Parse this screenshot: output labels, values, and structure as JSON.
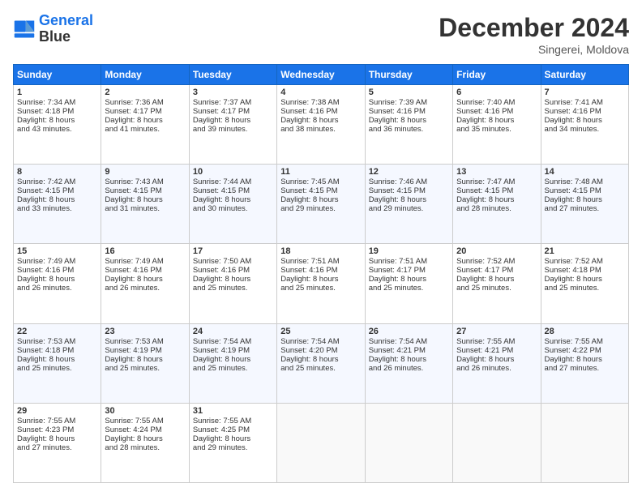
{
  "header": {
    "logo_line1": "General",
    "logo_line2": "Blue",
    "month_title": "December 2024",
    "location": "Singerei, Moldova"
  },
  "weekdays": [
    "Sunday",
    "Monday",
    "Tuesday",
    "Wednesday",
    "Thursday",
    "Friday",
    "Saturday"
  ],
  "weeks": [
    [
      {
        "day": "1",
        "lines": [
          "Sunrise: 7:34 AM",
          "Sunset: 4:18 PM",
          "Daylight: 8 hours",
          "and 43 minutes."
        ]
      },
      {
        "day": "2",
        "lines": [
          "Sunrise: 7:36 AM",
          "Sunset: 4:17 PM",
          "Daylight: 8 hours",
          "and 41 minutes."
        ]
      },
      {
        "day": "3",
        "lines": [
          "Sunrise: 7:37 AM",
          "Sunset: 4:17 PM",
          "Daylight: 8 hours",
          "and 39 minutes."
        ]
      },
      {
        "day": "4",
        "lines": [
          "Sunrise: 7:38 AM",
          "Sunset: 4:16 PM",
          "Daylight: 8 hours",
          "and 38 minutes."
        ]
      },
      {
        "day": "5",
        "lines": [
          "Sunrise: 7:39 AM",
          "Sunset: 4:16 PM",
          "Daylight: 8 hours",
          "and 36 minutes."
        ]
      },
      {
        "day": "6",
        "lines": [
          "Sunrise: 7:40 AM",
          "Sunset: 4:16 PM",
          "Daylight: 8 hours",
          "and 35 minutes."
        ]
      },
      {
        "day": "7",
        "lines": [
          "Sunrise: 7:41 AM",
          "Sunset: 4:16 PM",
          "Daylight: 8 hours",
          "and 34 minutes."
        ]
      }
    ],
    [
      {
        "day": "8",
        "lines": [
          "Sunrise: 7:42 AM",
          "Sunset: 4:15 PM",
          "Daylight: 8 hours",
          "and 33 minutes."
        ]
      },
      {
        "day": "9",
        "lines": [
          "Sunrise: 7:43 AM",
          "Sunset: 4:15 PM",
          "Daylight: 8 hours",
          "and 31 minutes."
        ]
      },
      {
        "day": "10",
        "lines": [
          "Sunrise: 7:44 AM",
          "Sunset: 4:15 PM",
          "Daylight: 8 hours",
          "and 30 minutes."
        ]
      },
      {
        "day": "11",
        "lines": [
          "Sunrise: 7:45 AM",
          "Sunset: 4:15 PM",
          "Daylight: 8 hours",
          "and 29 minutes."
        ]
      },
      {
        "day": "12",
        "lines": [
          "Sunrise: 7:46 AM",
          "Sunset: 4:15 PM",
          "Daylight: 8 hours",
          "and 29 minutes."
        ]
      },
      {
        "day": "13",
        "lines": [
          "Sunrise: 7:47 AM",
          "Sunset: 4:15 PM",
          "Daylight: 8 hours",
          "and 28 minutes."
        ]
      },
      {
        "day": "14",
        "lines": [
          "Sunrise: 7:48 AM",
          "Sunset: 4:15 PM",
          "Daylight: 8 hours",
          "and 27 minutes."
        ]
      }
    ],
    [
      {
        "day": "15",
        "lines": [
          "Sunrise: 7:49 AM",
          "Sunset: 4:16 PM",
          "Daylight: 8 hours",
          "and 26 minutes."
        ]
      },
      {
        "day": "16",
        "lines": [
          "Sunrise: 7:49 AM",
          "Sunset: 4:16 PM",
          "Daylight: 8 hours",
          "and 26 minutes."
        ]
      },
      {
        "day": "17",
        "lines": [
          "Sunrise: 7:50 AM",
          "Sunset: 4:16 PM",
          "Daylight: 8 hours",
          "and 25 minutes."
        ]
      },
      {
        "day": "18",
        "lines": [
          "Sunrise: 7:51 AM",
          "Sunset: 4:16 PM",
          "Daylight: 8 hours",
          "and 25 minutes."
        ]
      },
      {
        "day": "19",
        "lines": [
          "Sunrise: 7:51 AM",
          "Sunset: 4:17 PM",
          "Daylight: 8 hours",
          "and 25 minutes."
        ]
      },
      {
        "day": "20",
        "lines": [
          "Sunrise: 7:52 AM",
          "Sunset: 4:17 PM",
          "Daylight: 8 hours",
          "and 25 minutes."
        ]
      },
      {
        "day": "21",
        "lines": [
          "Sunrise: 7:52 AM",
          "Sunset: 4:18 PM",
          "Daylight: 8 hours",
          "and 25 minutes."
        ]
      }
    ],
    [
      {
        "day": "22",
        "lines": [
          "Sunrise: 7:53 AM",
          "Sunset: 4:18 PM",
          "Daylight: 8 hours",
          "and 25 minutes."
        ]
      },
      {
        "day": "23",
        "lines": [
          "Sunrise: 7:53 AM",
          "Sunset: 4:19 PM",
          "Daylight: 8 hours",
          "and 25 minutes."
        ]
      },
      {
        "day": "24",
        "lines": [
          "Sunrise: 7:54 AM",
          "Sunset: 4:19 PM",
          "Daylight: 8 hours",
          "and 25 minutes."
        ]
      },
      {
        "day": "25",
        "lines": [
          "Sunrise: 7:54 AM",
          "Sunset: 4:20 PM",
          "Daylight: 8 hours",
          "and 25 minutes."
        ]
      },
      {
        "day": "26",
        "lines": [
          "Sunrise: 7:54 AM",
          "Sunset: 4:21 PM",
          "Daylight: 8 hours",
          "and 26 minutes."
        ]
      },
      {
        "day": "27",
        "lines": [
          "Sunrise: 7:55 AM",
          "Sunset: 4:21 PM",
          "Daylight: 8 hours",
          "and 26 minutes."
        ]
      },
      {
        "day": "28",
        "lines": [
          "Sunrise: 7:55 AM",
          "Sunset: 4:22 PM",
          "Daylight: 8 hours",
          "and 27 minutes."
        ]
      }
    ],
    [
      {
        "day": "29",
        "lines": [
          "Sunrise: 7:55 AM",
          "Sunset: 4:23 PM",
          "Daylight: 8 hours",
          "and 27 minutes."
        ]
      },
      {
        "day": "30",
        "lines": [
          "Sunrise: 7:55 AM",
          "Sunset: 4:24 PM",
          "Daylight: 8 hours",
          "and 28 minutes."
        ]
      },
      {
        "day": "31",
        "lines": [
          "Sunrise: 7:55 AM",
          "Sunset: 4:25 PM",
          "Daylight: 8 hours",
          "and 29 minutes."
        ]
      },
      null,
      null,
      null,
      null
    ]
  ]
}
